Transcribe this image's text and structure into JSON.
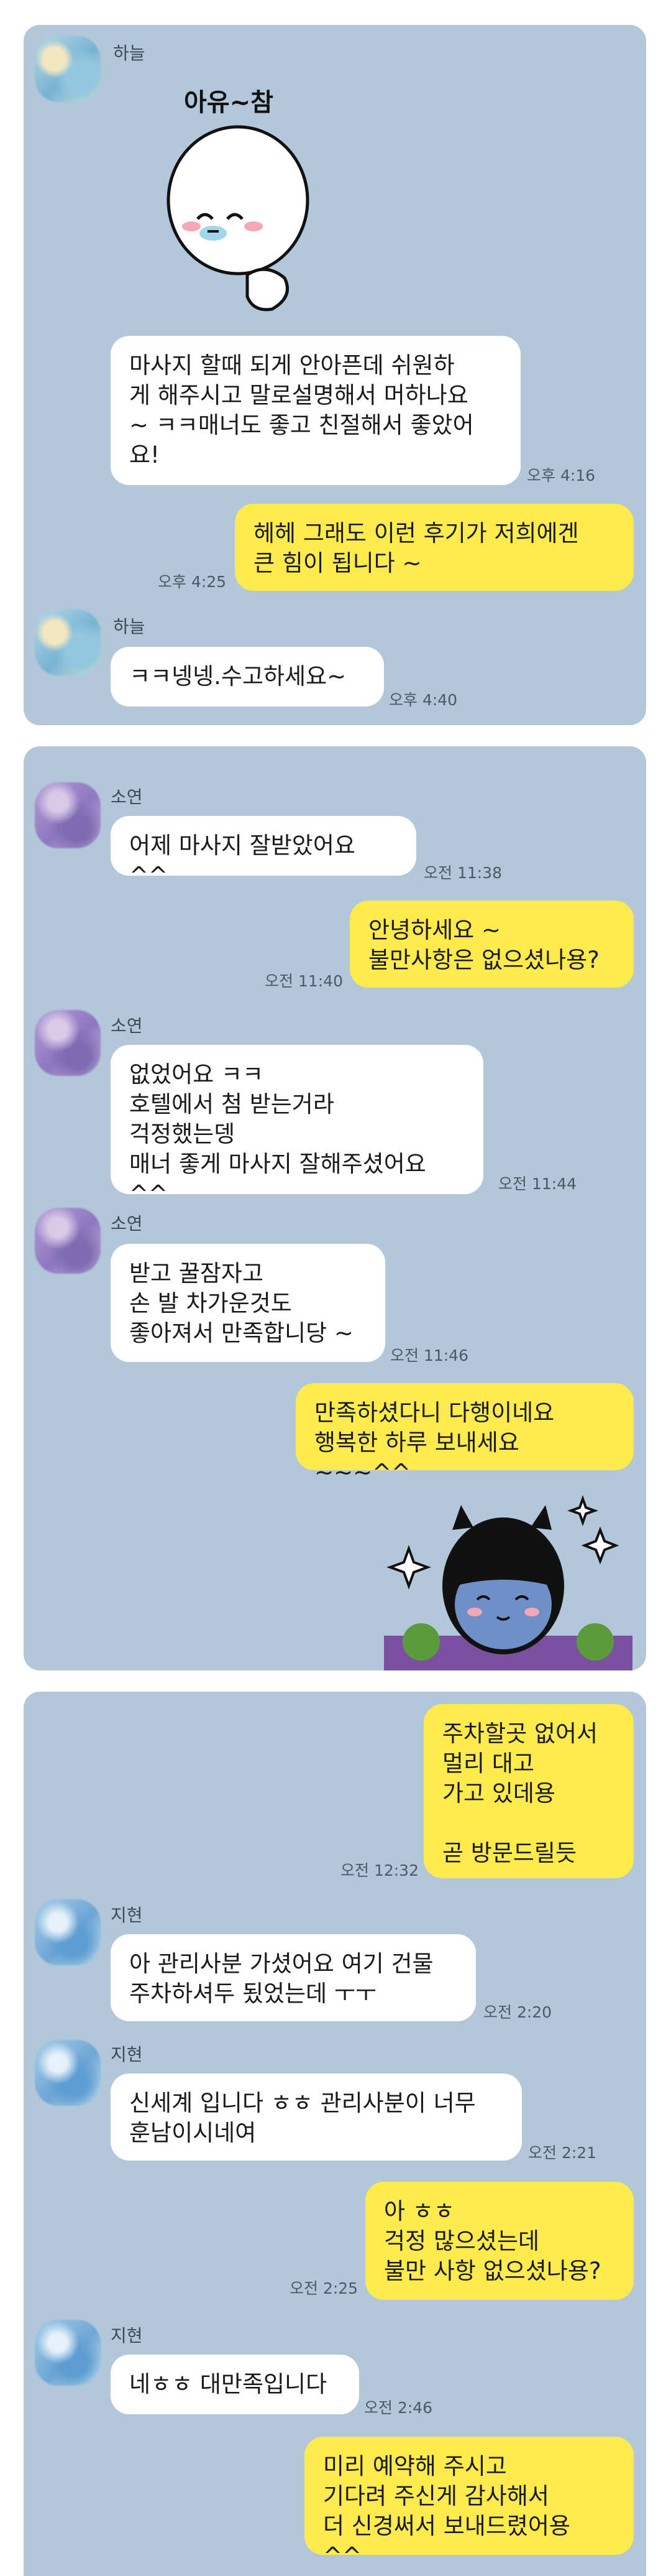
{
  "panels": [
    {
      "messages": [
        {
          "sender": "하늘",
          "type": "sticker",
          "sticker_text": "아유~참"
        },
        {
          "sender": "하늘",
          "type": "text",
          "text": "마사지 할때 되게 안아픈데 쉬원하\n게 해주시고 말로설명해서 머하나요\n~ ㅋㅋ매너도 좋고 친절해서 좋았어\n요!",
          "time": "오후 4:16"
        },
        {
          "sender": "me",
          "type": "text",
          "text": "헤헤 그래도 이런 후기가 저희에겐\n큰 힘이 됩니다 ~",
          "time": "오후 4:25"
        },
        {
          "sender": "하늘",
          "type": "text",
          "text": "ㅋㅋ넹넹.수고하세요~",
          "time": "오후 4:40"
        }
      ]
    },
    {
      "messages": [
        {
          "sender": "소연",
          "type": "text",
          "text": "어제 마사지 잘받았어요 ^^",
          "time": "오전 11:38"
        },
        {
          "sender": "me",
          "type": "text",
          "text": "안녕하세요 ~\n불만사항은 없으셨나용?",
          "time": "오전 11:40"
        },
        {
          "sender": "소연",
          "type": "text",
          "text": "없었어요 ㅋㅋ\n호텔에서 첨 받는거라\n걱정했는뎅\n매너 좋게 마사지 잘해주셨어요 ^^",
          "time": "오전 11:44"
        },
        {
          "sender": "소연",
          "type": "text",
          "text": "받고 꿀잠자고\n손 발 차가운것도\n좋아져서 만족합니당 ~",
          "time": "오전 11:46"
        },
        {
          "sender": "me",
          "type": "text",
          "text": "만족하셨다니 다행이네요\n행복한 하루 보내세요 ~~~^^"
        },
        {
          "sender": "me",
          "type": "sticker",
          "sticker": "happy-character"
        }
      ]
    },
    {
      "messages": [
        {
          "sender": "me",
          "type": "text",
          "text": "주차할곳 없어서\n멀리 대고\n가고 있데용\n\n곧 방문드릴듯",
          "time": "오전 12:32"
        },
        {
          "sender": "지현",
          "type": "text",
          "text": "아 관리사분 가셨어요 여기 건물\n주차하셔두 됬었는데 ㅜㅜ",
          "time": "오전 2:20"
        },
        {
          "sender": "지현",
          "type": "text",
          "text": "신세계 입니다 ㅎㅎ 관리사분이 너무\n훈남이시네여",
          "time": "오전 2:21"
        },
        {
          "sender": "me",
          "type": "text",
          "text": "아 ㅎㅎ\n걱정 많으셨는데\n불만 사항 없으셨나용?",
          "time": "오전 2:25"
        },
        {
          "sender": "지현",
          "type": "text",
          "text": "네ㅎㅎ 대만족입니다",
          "time": "오전 2:46"
        },
        {
          "sender": "me",
          "type": "text",
          "text": "미리 예약해 주시고\n기다려 주신게 감사해서\n더 신경써서 보내드렸어용 ^^"
        }
      ]
    }
  ],
  "colors": {
    "panel_bg": "#b2c7da",
    "incoming": "#ffffff",
    "outgoing": "#fdeb4c"
  }
}
